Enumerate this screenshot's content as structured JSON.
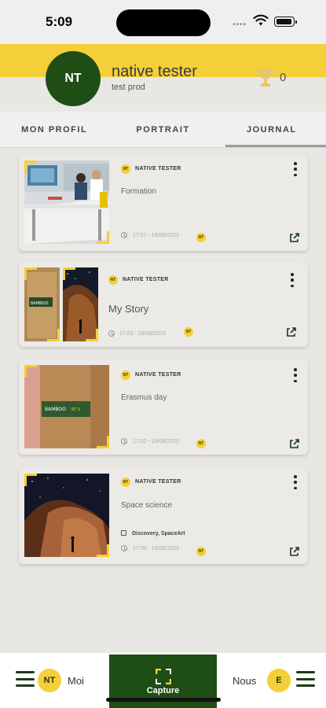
{
  "status_bar": {
    "time": "5:09",
    "signal": "••••"
  },
  "profile": {
    "initials": "NT",
    "name": "native tester",
    "subtitle": "test prod",
    "trophy_count": "0"
  },
  "tabs": [
    {
      "label": "MON PROFIL",
      "active": false
    },
    {
      "label": "PORTRAIT",
      "active": false
    },
    {
      "label": "JOURNAL",
      "active": true
    }
  ],
  "posts": [
    {
      "author": "NATIVE TESTER",
      "title": "Formation",
      "timestamp": "17:07 - 19/06/2023",
      "badge": "NT",
      "image": "office-meeting"
    },
    {
      "author": "NATIVE TESTER",
      "title": "My Story",
      "timestamp": "17:03 - 19/06/2023",
      "badge": "NT",
      "image": "cup-and-desert"
    },
    {
      "author": "NATIVE TESTER",
      "title": "Erasmus day",
      "timestamp": "17:02 - 19/06/2023",
      "badge": "NT",
      "image": "cardboard-cup"
    },
    {
      "author": "NATIVE TESTER",
      "title": "Space science",
      "tags": "Discovery, SpaceArt",
      "timestamp": "17:00 - 19/06/2023",
      "badge": "NT",
      "image": "night-sky-rock"
    }
  ],
  "cup_print": {
    "brand": "BAMBOO",
    "text": "RT S"
  },
  "bottom_nav": {
    "left": {
      "initials": "NT",
      "label": "Moi"
    },
    "center": {
      "label": "Capture"
    },
    "right": {
      "initials": "E",
      "label": "Nous"
    }
  },
  "colors": {
    "brand_yellow": "#f5cf37",
    "brand_green": "#1e4d16",
    "background": "#e9e7e3"
  }
}
